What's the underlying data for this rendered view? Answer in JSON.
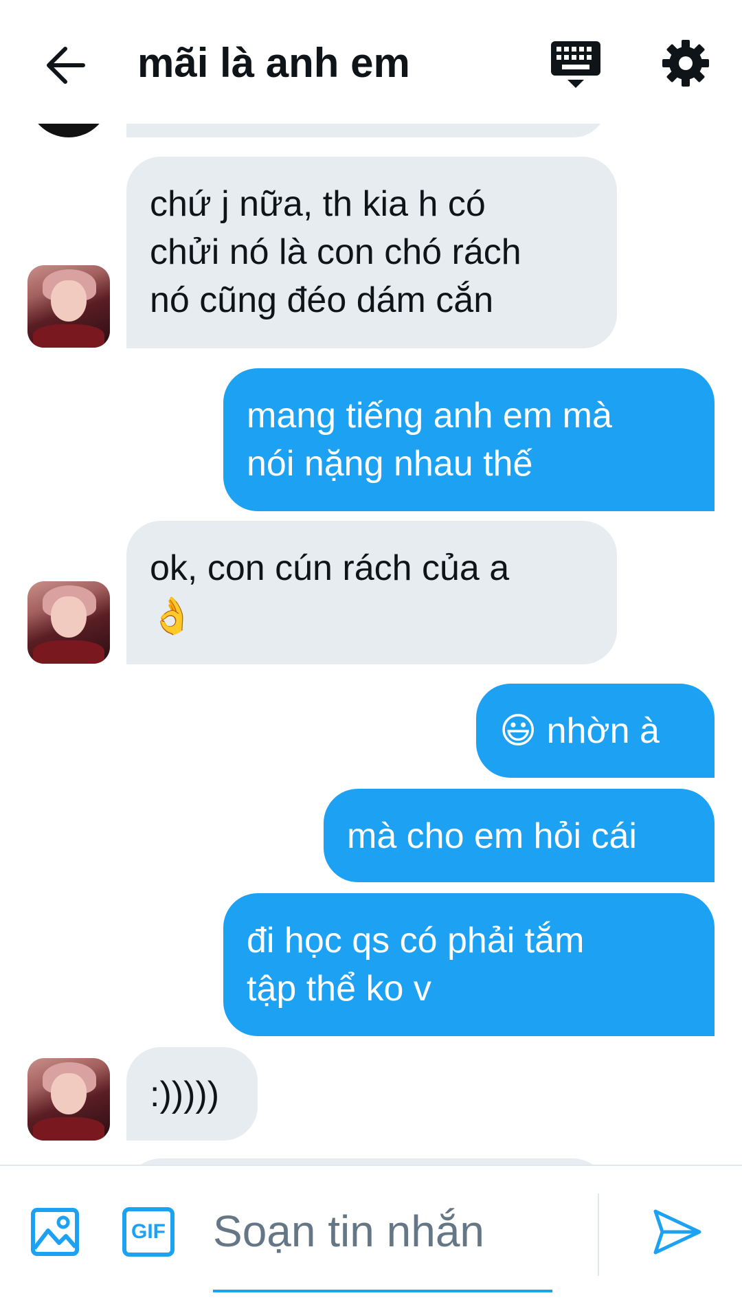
{
  "header": {
    "title": "mãi là anh em",
    "icons": {
      "back": "arrow-left-icon",
      "keyboard": "keyboard-icon",
      "settings": "gear-icon"
    }
  },
  "messages": [
    {
      "direction": "in",
      "lines": [
        "chứ j nữa, th kia h có",
        "chửi nó là con chó rách",
        "nó cũng đéo dám cắn"
      ]
    },
    {
      "direction": "out",
      "lines": [
        "mang tiếng anh em mà",
        "nói nặng nhau thế"
      ]
    },
    {
      "direction": "in",
      "lines": [
        "ok, con cún rách của a",
        "👌"
      ]
    },
    {
      "direction": "out",
      "lines": [
        "😃 nhờn à"
      ]
    },
    {
      "direction": "out",
      "lines": [
        "mà cho em hỏi cái"
      ]
    },
    {
      "direction": "out",
      "lines": [
        "đi học qs có phải tắm",
        "tập thể ko v"
      ]
    },
    {
      "direction": "in",
      "lines": [
        ":)))))"
      ]
    }
  ],
  "composer": {
    "placeholder": "Soạn tin nhắn",
    "gif_label": "GIF",
    "icons": {
      "media": "image-icon",
      "send": "send-icon"
    }
  },
  "colors": {
    "accent": "#1da1f2",
    "incoming_bubble": "#e6ecf0",
    "text": "#0f1419",
    "placeholder": "#657786"
  }
}
